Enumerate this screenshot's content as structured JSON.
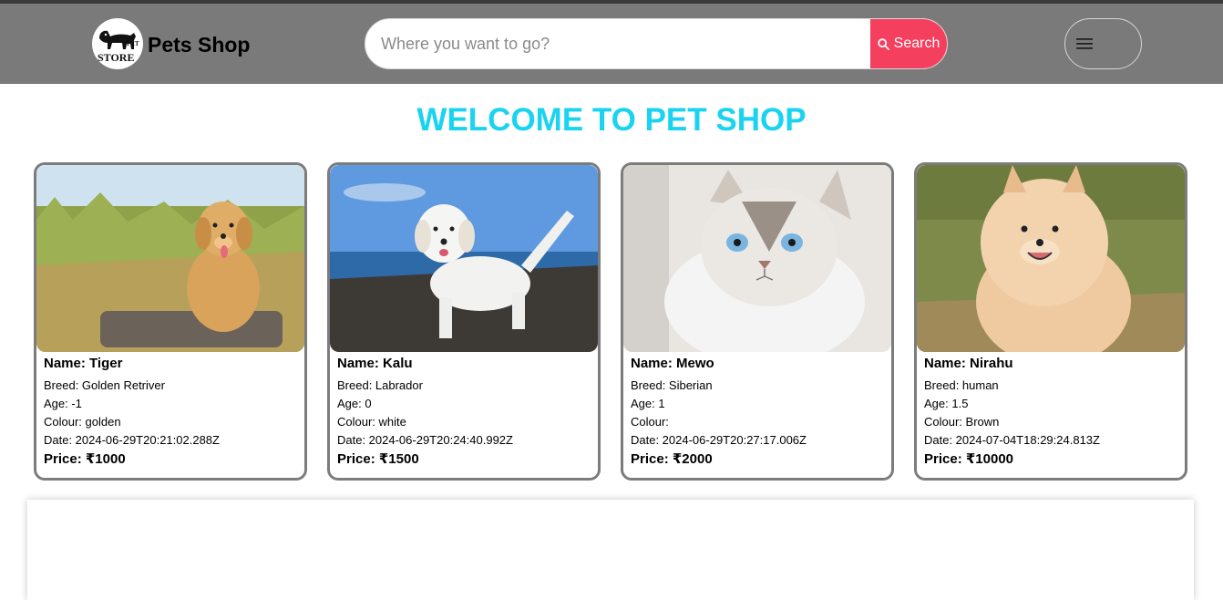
{
  "header": {
    "brand": "Pets Shop",
    "logo_text_top": "PET",
    "logo_text_bottom": "STORE",
    "search_placeholder": "Where you want to go?",
    "search_label": "Search",
    "colors": {
      "navbar": "#7a7a7a",
      "search_button": "#f43f5e"
    },
    "icons": [
      "search-icon",
      "menu-icon"
    ]
  },
  "main": {
    "welcome": "WELCOME TO PET SHOP",
    "welcome_color": "#1ad3f0"
  },
  "pets": [
    {
      "name": "Name: Tiger",
      "breed": "Breed: Golden Retriver",
      "age": "Age: -1",
      "colour": "Colour: golden",
      "date": "Date: 2024-06-29T20:21:02.288Z",
      "price": "Price: ₹1000"
    },
    {
      "name": "Name: Kalu",
      "breed": "Breed: Labrador",
      "age": "Age: 0",
      "colour": "Colour: white",
      "date": "Date: 2024-06-29T20:24:40.992Z",
      "price": "Price: ₹1500"
    },
    {
      "name": "Name: Mewo",
      "breed": "Breed: Siberian",
      "age": "Age: 1",
      "colour": "Colour: ",
      "date": "Date: 2024-06-29T20:27:17.006Z",
      "price": "Price: ₹2000"
    },
    {
      "name": "Name: Nirahu",
      "breed": "Breed: human",
      "age": "Age: 1.5",
      "colour": "Colour: Brown",
      "date": "Date: 2024-07-04T18:29:24.813Z",
      "price": "Price: ₹10000"
    }
  ]
}
